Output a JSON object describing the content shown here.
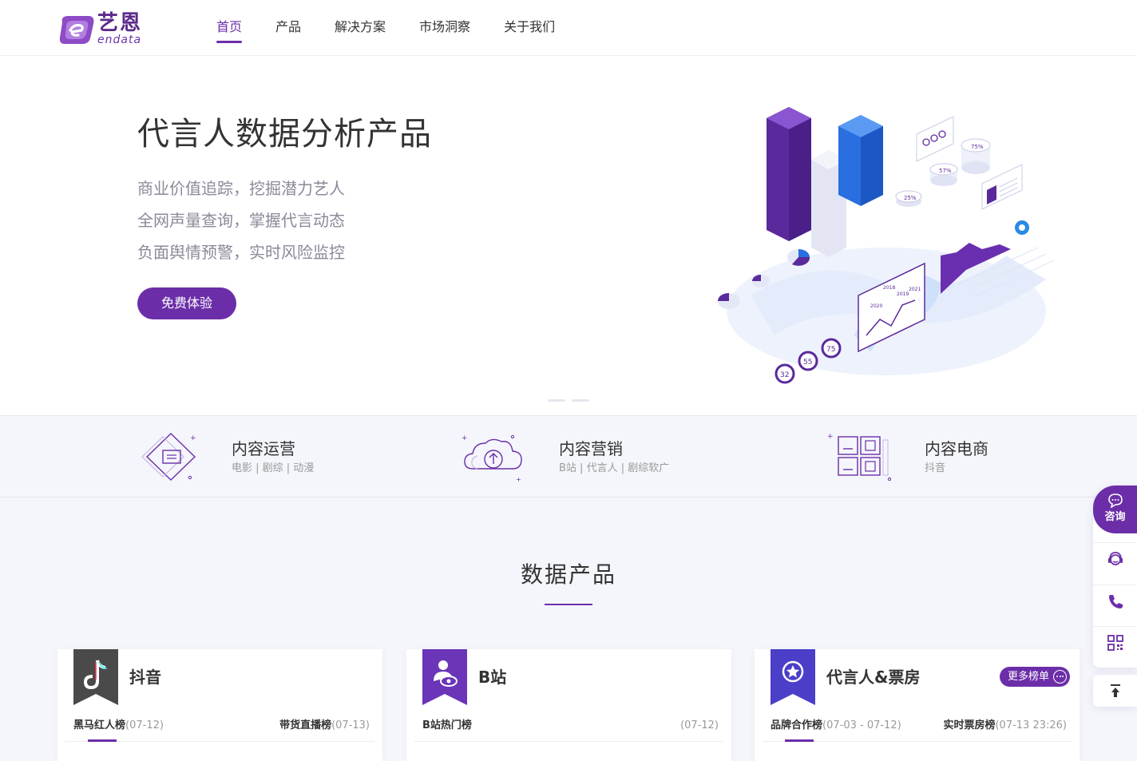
{
  "brand": {
    "name_cn": "艺恩",
    "name_en": "endata",
    "color": "#6c2ea8"
  },
  "nav": {
    "items": [
      {
        "label": "首页",
        "active": true
      },
      {
        "label": "产品",
        "active": false
      },
      {
        "label": "解决方案",
        "active": false
      },
      {
        "label": "市场洞察",
        "active": false
      },
      {
        "label": "关于我们",
        "active": false
      }
    ]
  },
  "hero": {
    "title": "代言人数据分析产品",
    "lines": [
      "商业价值追踪，挖掘潜力艺人",
      "全网声量查询，掌握代言动态",
      "负面舆情预警，实时风险监控"
    ],
    "cta_label": "免费体验",
    "illustration_labels": [
      "75",
      "55",
      "32",
      "75%",
      "57%",
      "25%",
      "2018",
      "2019",
      "2020",
      "2021"
    ]
  },
  "features": [
    {
      "title": "内容运营",
      "subtitle": "电影 | 剧综 | 动漫",
      "icon": "content-ops-icon"
    },
    {
      "title": "内容营销",
      "subtitle": "B站 | 代言人 | 剧综软广",
      "icon": "cloud-upload-icon"
    },
    {
      "title": "内容电商",
      "subtitle": "抖音",
      "icon": "grid-windows-icon"
    }
  ],
  "section": {
    "title": "数据产品"
  },
  "cards": [
    {
      "name": "抖音",
      "icon": "tiktok-icon",
      "tabs": [
        {
          "label": "黑马红人榜",
          "date": "(07-12)"
        },
        {
          "label": "带货直播榜",
          "date": "(07-13)"
        }
      ]
    },
    {
      "name": "B站",
      "icon": "bilibili-eye-icon",
      "tabs": [
        {
          "label": "B站热门榜",
          "date": ""
        },
        {
          "label": "",
          "date": "(07-12)"
        }
      ]
    },
    {
      "name": "代言人&票房",
      "icon": "star-badge-icon",
      "more_label": "更多榜单",
      "tabs": [
        {
          "label": "品牌合作榜",
          "date": "(07-03 - 07-12)"
        },
        {
          "label": "实时票房榜",
          "date": "(07-13 23:26)"
        }
      ]
    }
  ],
  "sidebar": {
    "consult_label": "咨询",
    "items": [
      "customer-service-icon",
      "phone-icon",
      "qrcode-icon"
    ],
    "back_to_top": "back-to-top-icon"
  }
}
